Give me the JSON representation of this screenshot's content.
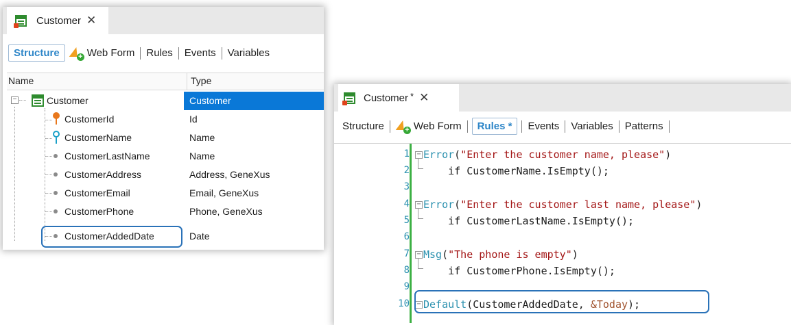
{
  "left": {
    "tab_title": "Customer",
    "close": "✕",
    "subtabs": [
      "Structure",
      "Web Form",
      "Rules",
      "Events",
      "Variables"
    ],
    "columns": {
      "name": "Name",
      "type": "Type"
    },
    "rows": [
      {
        "name": "Customer",
        "type": "Customer"
      },
      {
        "name": "CustomerId",
        "type": "Id"
      },
      {
        "name": "CustomerName",
        "type": "Name"
      },
      {
        "name": "CustomerLastName",
        "type": "Name"
      },
      {
        "name": "CustomerAddress",
        "type": "Address, GeneXus"
      },
      {
        "name": "CustomerEmail",
        "type": "Email, GeneXus"
      },
      {
        "name": "CustomerPhone",
        "type": "Phone, GeneXus"
      },
      {
        "name": "CustomerAddedDate",
        "type": "Date"
      }
    ]
  },
  "right": {
    "tab_title": "Customer",
    "modified_mark": "*",
    "close": "✕",
    "subtabs": [
      "Structure",
      "Web Form",
      "Rules *",
      "Events",
      "Variables",
      "Patterns"
    ],
    "line_numbers": [
      "1",
      "2",
      "3",
      "4",
      "5",
      "6",
      "7",
      "8",
      "9",
      "10"
    ],
    "code": {
      "l1_kw": "Error",
      "l1_open": "(",
      "l1_str": "\"Enter the customer name, please\"",
      "l1_close": ")",
      "l2": "    if CustomerName.IsEmpty();",
      "l4_kw": "Error",
      "l4_open": "(",
      "l4_str": "\"Enter the customer last name, please\"",
      "l4_close": ")",
      "l5": "    if CustomerLastName.IsEmpty();",
      "l7_kw": "Msg",
      "l7_open": "(",
      "l7_str": "\"The phone is empty\"",
      "l7_close": ")",
      "l8": "    if CustomerPhone.IsEmpty();",
      "l10_kw": "Default",
      "l10_args": "(CustomerAddedDate, ",
      "l10_var": "&Today",
      "l10_close": ");"
    }
  },
  "colors": {
    "selection": "#0a78d7",
    "highlight_box": "#2a72b8",
    "keyword": "#2b91af",
    "string": "#a31515"
  }
}
